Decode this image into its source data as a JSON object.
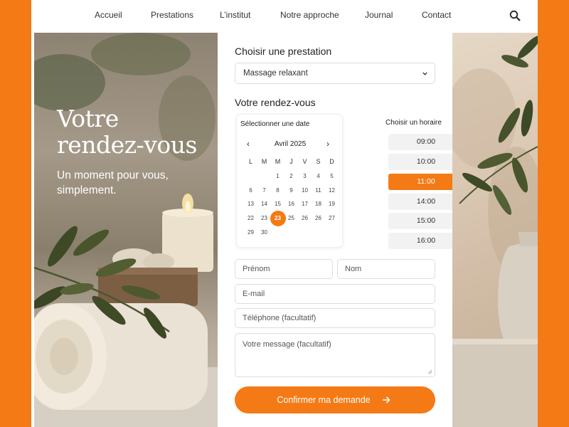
{
  "nav": {
    "items": [
      "Accueil",
      "Prestations",
      "L’institut",
      "Notre approche",
      "Journal",
      "Contact"
    ]
  },
  "hero": {
    "title_line1": "Votre",
    "title_line2": "rendez-vous",
    "subtitle": "Un moment pour vous, simplement."
  },
  "form": {
    "service_heading": "Choisir une prestation",
    "service_value": "Massage relaxant",
    "appointment_heading": "Votre rendez-vous",
    "calendar": {
      "caption": "Sélectionner une date",
      "month": "Avril 2025",
      "prev": "‹",
      "next": "›",
      "weekdays": [
        "L",
        "M",
        "M",
        "J",
        "V",
        "S",
        "D"
      ],
      "days": [
        [
          "",
          "",
          "1",
          "2",
          "3",
          "4",
          "5"
        ],
        [
          "6",
          "7",
          "8",
          "9",
          "10",
          "11",
          "12"
        ],
        [
          "13",
          "14",
          "15",
          "16",
          "17",
          "18",
          "19"
        ],
        [
          "22",
          "23",
          "23",
          "25",
          "26",
          "26",
          "27"
        ],
        [
          "29",
          "30",
          "",
          "",
          "",
          "",
          ""
        ]
      ],
      "selected_day": "23"
    },
    "time": {
      "caption": "Choisir un horaire",
      "slots": [
        "09:00",
        "10:00",
        "11:00",
        "14:00",
        "15:00",
        "16:00"
      ],
      "selected": "11:00"
    },
    "fields": {
      "first_name": "Prénom",
      "last_name": "Nom",
      "email": "E-mail",
      "phone": "Téléphone (facultatif)",
      "message": "Votre message (facultatif)"
    },
    "submit_label": "Confirmer ma demande"
  },
  "colors": {
    "accent": "#f47a16"
  }
}
